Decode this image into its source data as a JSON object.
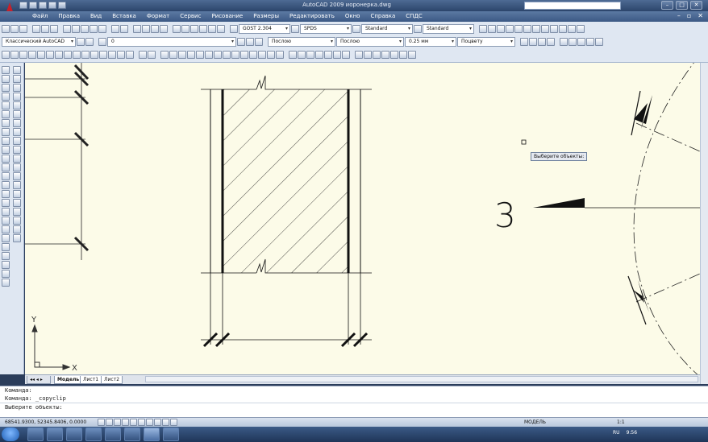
{
  "window": {
    "title": "AutoCAD 2009 иоронерка.dwg"
  },
  "menu": [
    "Файл",
    "Правка",
    "Вид",
    "Вставка",
    "Формат",
    "Сервис",
    "Рисование",
    "Размеры",
    "Редактировать",
    "Окно",
    "Справка",
    "СПДС"
  ],
  "toolbar": {
    "text_style": "GOST 2.304",
    "dim_style": "SPDS",
    "table_style": "Standard",
    "mleader_style": "Standard",
    "workspace": "Классический AutoCAD",
    "layer": "0",
    "color": "Послою",
    "linetype": "Послою",
    "lineweight": "0.25 мм",
    "plot_style": "Поцвету"
  },
  "drawing": {
    "label": "3",
    "tooltip": "Выберите объекты:"
  },
  "ucs": {
    "y": "Y",
    "x": "X"
  },
  "tabs": {
    "model": "Модель",
    "sheet1": "Лист1",
    "sheet2": "Лист2"
  },
  "command": {
    "line1": "Команда:",
    "line2": "Команда: _copyclip",
    "line3": "Выберите объекты:"
  },
  "status": {
    "coords": "68541.9300, 52345.8406, 0.0000",
    "mode": "МОДЕЛЬ",
    "scale": "1:1"
  },
  "tray": {
    "lang": "RU",
    "time": "9:56"
  },
  "colors": {
    "canvas": "#fcfbe8",
    "ribbon": "#dfe7f2",
    "title": "#2c456b"
  }
}
